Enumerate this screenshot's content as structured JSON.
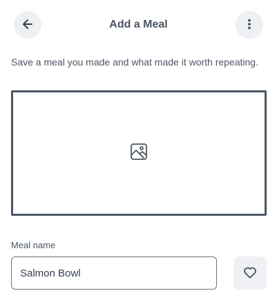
{
  "header": {
    "title": "Add a Meal",
    "back_icon": "arrow-left-icon",
    "more_icon": "more-vertical-icon"
  },
  "subtitle": "Save a meal you made and what made it worth repeating.",
  "photo": {
    "icon": "image-icon"
  },
  "meal_name": {
    "label": "Meal name",
    "value": "Salmon Bowl"
  },
  "favorite": {
    "icon": "heart-icon"
  },
  "colors": {
    "icon_button_bg": "#eef0f3",
    "text": "#4b5563",
    "border": "#4b5563"
  }
}
